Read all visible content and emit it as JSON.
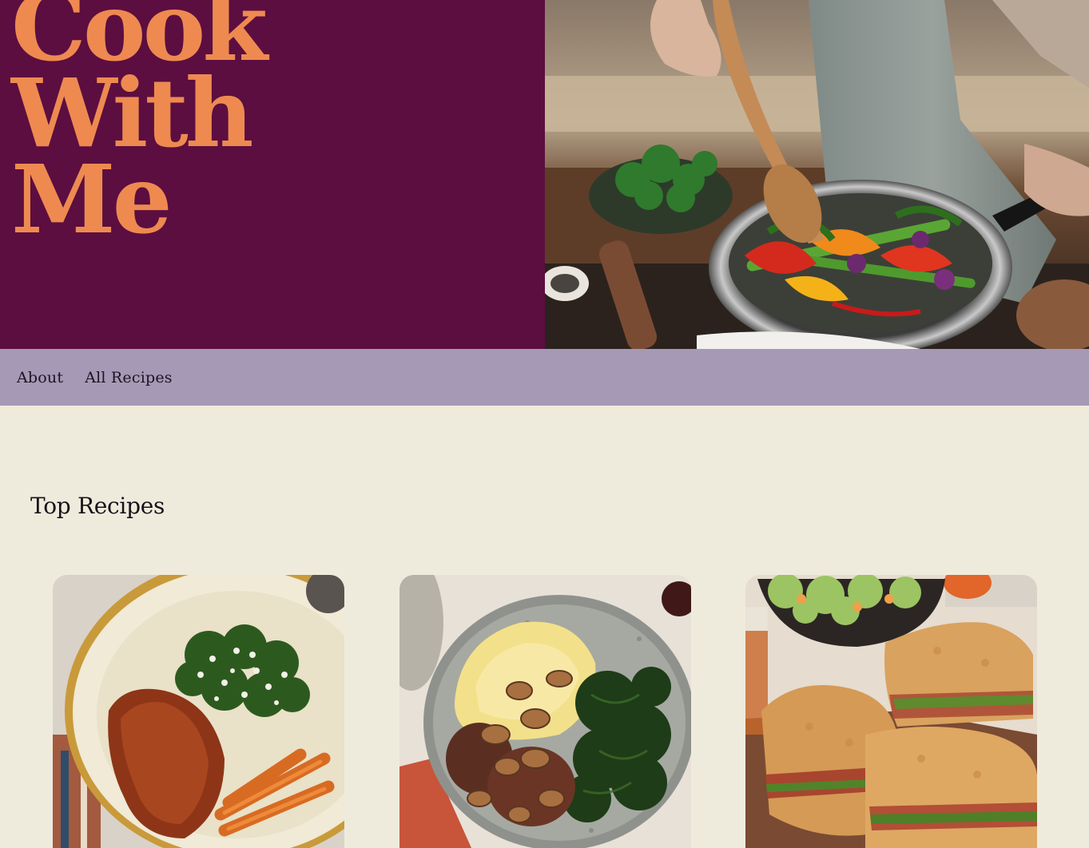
{
  "hero": {
    "brand_line_1": "Cook",
    "brand_line_2": "With",
    "brand_line_3": "Me",
    "image_alt": "Person stirring vegetables in a pan"
  },
  "nav": {
    "items": [
      {
        "label": "About"
      },
      {
        "label": "All Recipes"
      }
    ]
  },
  "main": {
    "section_title": "Top Recipes",
    "recipes": [
      {
        "image_alt": "Chicken with kale rice and roasted carrots"
      },
      {
        "image_alt": "Salisbury steak with mashed potatoes and kale"
      },
      {
        "image_alt": "Focaccia sandwiches with salad"
      }
    ]
  },
  "colors": {
    "hero_bg": "#5c0e40",
    "brand_text": "#ee8a50",
    "nav_bg": "#a699b6",
    "page_bg": "#efebdc"
  }
}
